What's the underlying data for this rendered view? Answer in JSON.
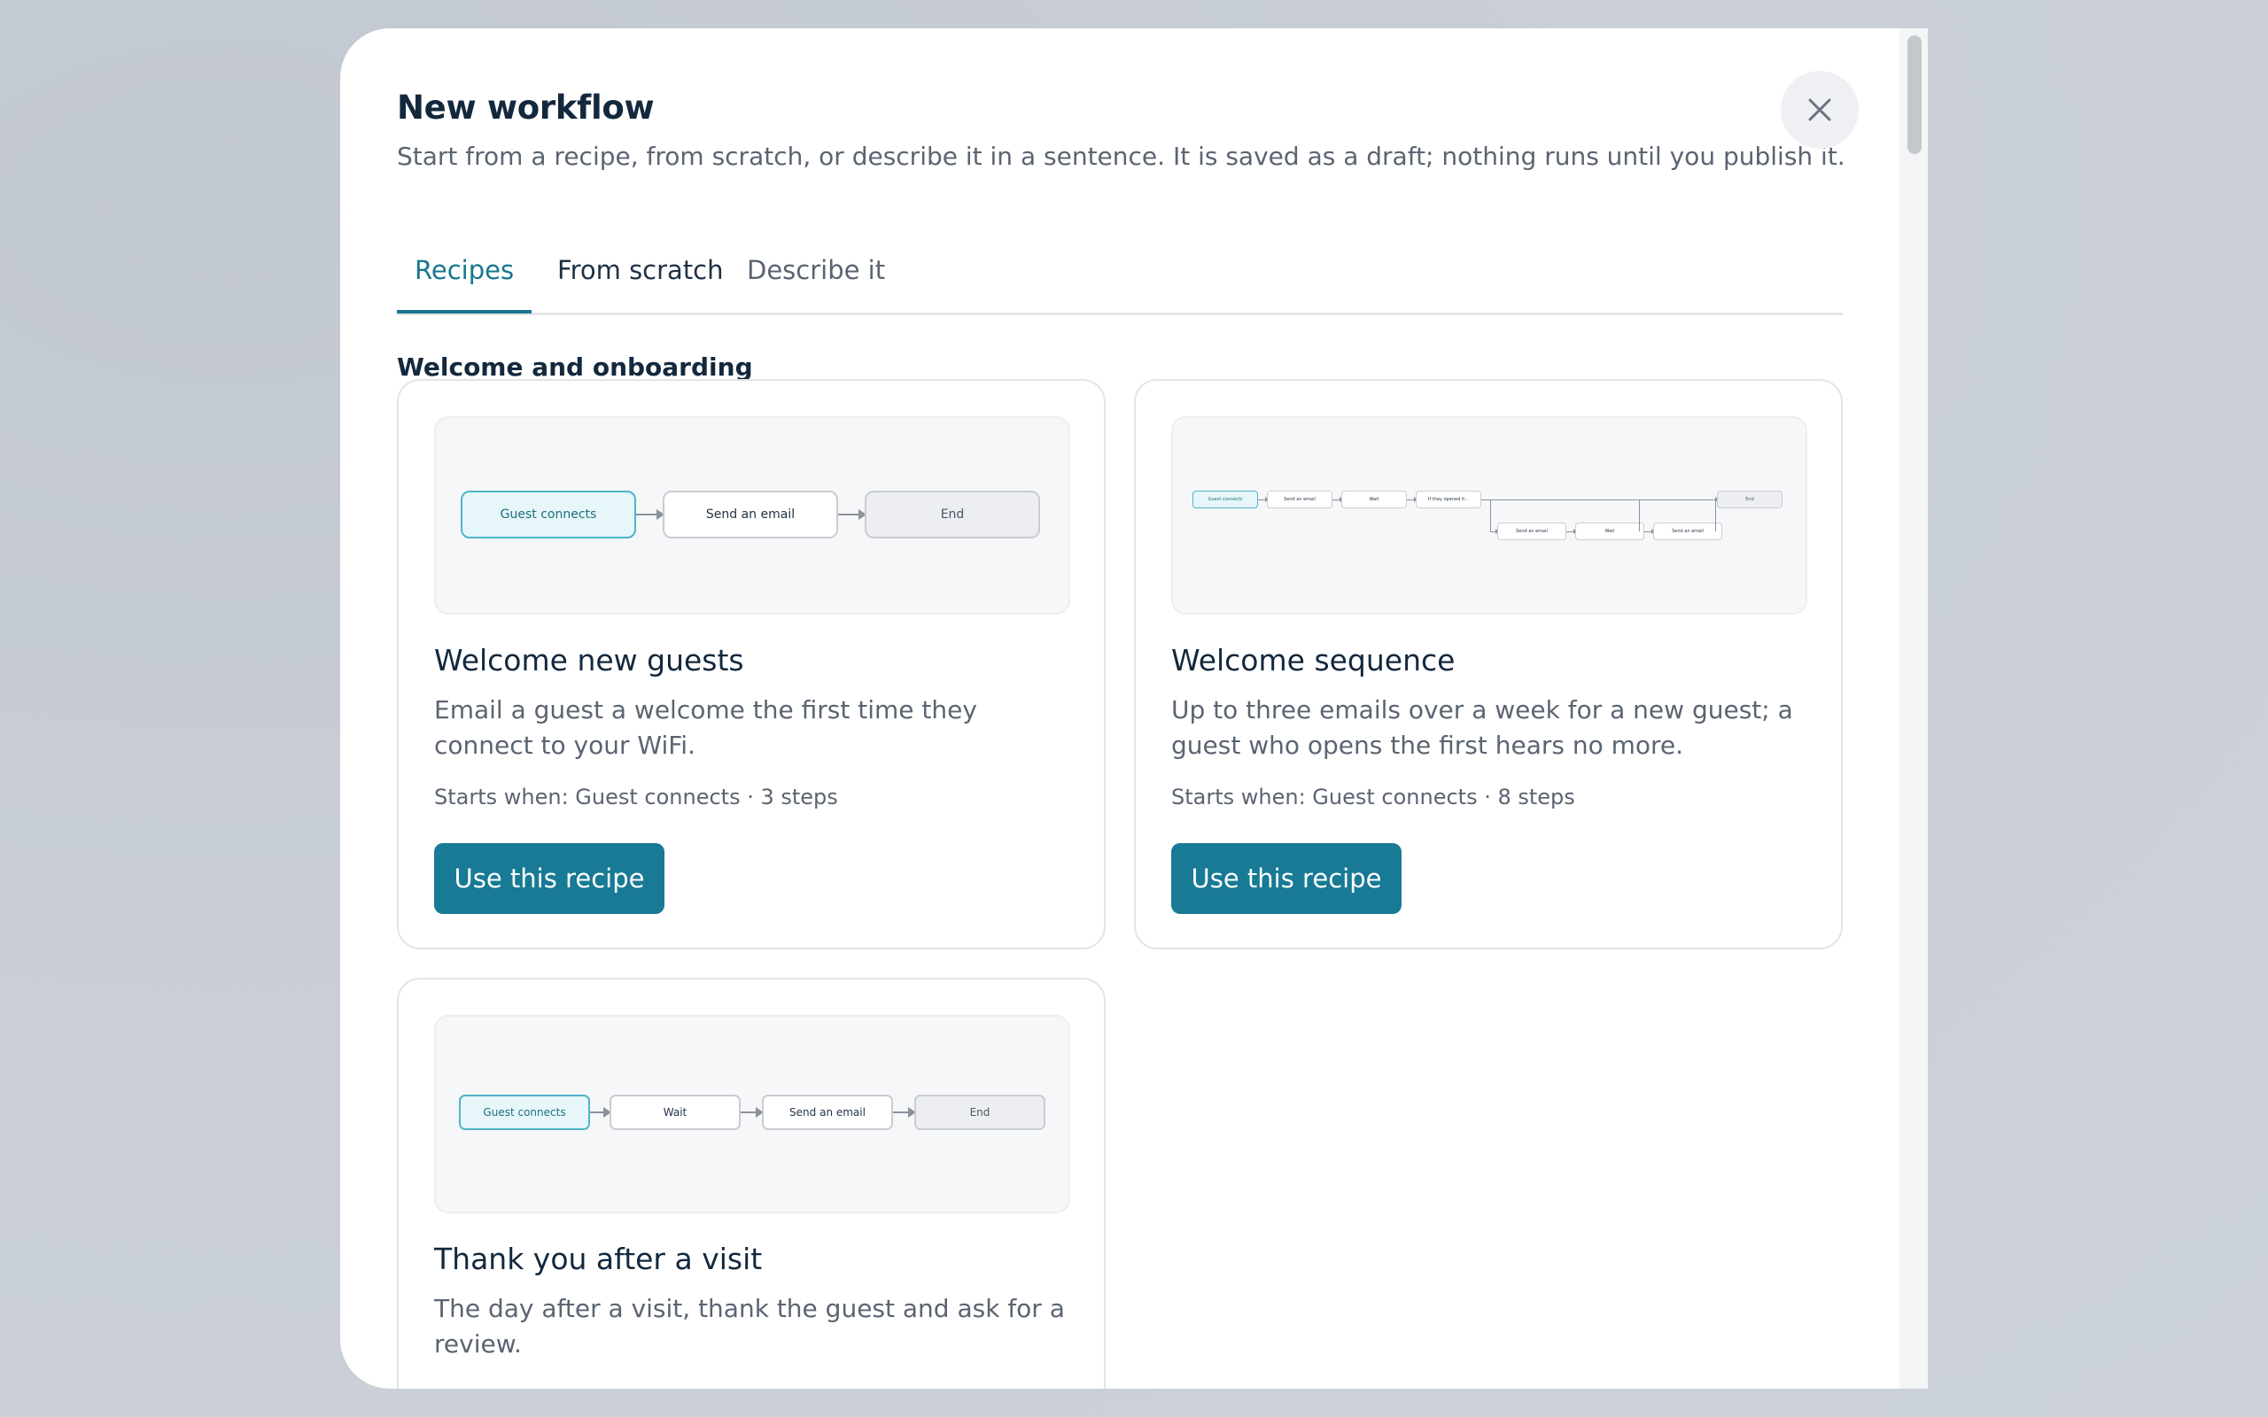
{
  "modal": {
    "title": "New workflow",
    "subtitle": "Start from a recipe, from scratch, or describe it in a sentence. It is saved as a draft; nothing runs until you publish it.",
    "close_icon": "close-icon"
  },
  "tabs": [
    {
      "label": "Recipes",
      "active": true
    },
    {
      "label": "From scratch",
      "active": false
    },
    {
      "label": "Describe it",
      "active": false
    }
  ],
  "section": {
    "title": "Welcome and onboarding"
  },
  "recipes": [
    {
      "title": "Welcome new guests",
      "description": "Email a guest a welcome the first time they connect to your WiFi.",
      "meta": "Starts when: Guest connects · 3 steps",
      "button": "Use this recipe",
      "diagram": {
        "nodes": [
          "Guest connects",
          "Send an email",
          "End"
        ]
      }
    },
    {
      "title": "Welcome sequence",
      "description": "Up to three emails over a week for a new guest; a guest who opens the first hears no more.",
      "meta": "Starts when: Guest connects · 8 steps",
      "button": "Use this recipe",
      "diagram": {
        "nodes": [
          "Guest connects",
          "Send an email",
          "Wait",
          "If they opened it...",
          "End",
          "Send an email",
          "Wait",
          "Send an email"
        ]
      }
    },
    {
      "title": "Thank you after a visit",
      "description": "The day after a visit, thank the guest and ask for a review.",
      "meta": "",
      "button": "",
      "diagram": {
        "nodes": [
          "Guest connects",
          "Wait",
          "Send an email",
          "End"
        ]
      }
    }
  ],
  "colors": {
    "accent": "#187a94",
    "trigger_fill": "#e6f6f9",
    "trigger_border": "#4fb5c8",
    "text_primary": "#13283d",
    "text_secondary": "#5b6472"
  }
}
